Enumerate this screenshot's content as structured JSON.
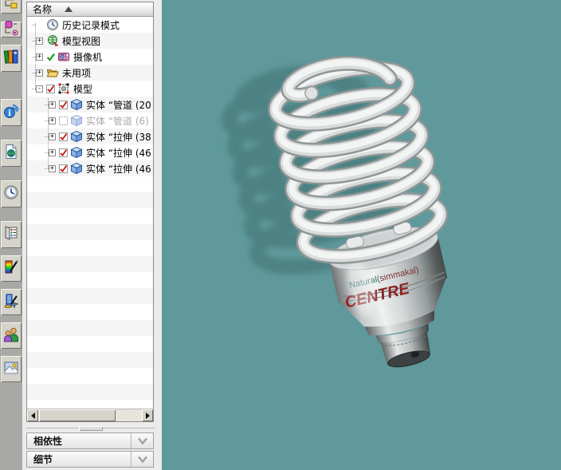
{
  "colors": {
    "viewport_bg": "#5f999b",
    "shadow": "#4b7f81",
    "accent_red_check": "#c11515",
    "panel_bg": "#ebebeb"
  },
  "toolbar": {
    "buttons": [
      {
        "icon": "scene-tree-icon"
      },
      {
        "icon": "database-tree-icon"
      },
      {
        "icon": "catalog-books-icon"
      },
      {
        "icon": "info-signal-icon"
      },
      {
        "icon": "web-document-icon"
      },
      {
        "icon": "clock-icon"
      },
      {
        "icon": "panel-door-icon"
      },
      {
        "icon": "color-wand-icon"
      },
      {
        "icon": "smart-render-icon"
      },
      {
        "icon": "collaboration-people-icon"
      },
      {
        "icon": "image-icon"
      }
    ]
  },
  "tree": {
    "header": {
      "label": "名称",
      "sort": "ascending"
    },
    "items": [
      {
        "label": "历史记录模式",
        "icon": "history-clock-icon",
        "expand": "",
        "check": "none",
        "disabled": false
      },
      {
        "label": "模型视图",
        "icon": "model-views-icon",
        "expand": "+",
        "check": "none",
        "disabled": false
      },
      {
        "label": "摄像机",
        "icon": "camera-icon",
        "expand": "+",
        "check": "green-check",
        "disabled": false
      },
      {
        "label": "未用项",
        "icon": "folder-open-icon",
        "expand": "+",
        "check": "none",
        "disabled": false
      },
      {
        "label": "模型",
        "icon": "model-icon",
        "expand": "-",
        "check": "red-check",
        "disabled": false
      },
      {
        "label": "实体 “管道 (20",
        "icon": "solid-cube-icon",
        "expand": "+",
        "check": "red-check",
        "disabled": false
      },
      {
        "label": "实体 “管道 (6)",
        "icon": "solid-cube-icon",
        "expand": "+",
        "check": "unchecked",
        "disabled": true
      },
      {
        "label": "实体 “拉伸 (38",
        "icon": "solid-cube-icon",
        "expand": "+",
        "check": "red-check",
        "disabled": false
      },
      {
        "label": "实体 “拉伸 (46",
        "icon": "solid-cube-icon",
        "expand": "+",
        "check": "red-check",
        "disabled": false
      },
      {
        "label": "实体 “拉伸 (46",
        "icon": "solid-cube-icon",
        "expand": "+",
        "check": "red-check",
        "disabled": false
      }
    ]
  },
  "panels": {
    "dependency": {
      "label": "相依性"
    },
    "detail": {
      "label": "细节"
    }
  },
  "viewport": {
    "model": {
      "kind": "spiral-cfl-bulb",
      "base_text_1a": "Natural(",
      "base_text_1b": "simmakal)",
      "base_text_2": "CENTRE"
    }
  }
}
